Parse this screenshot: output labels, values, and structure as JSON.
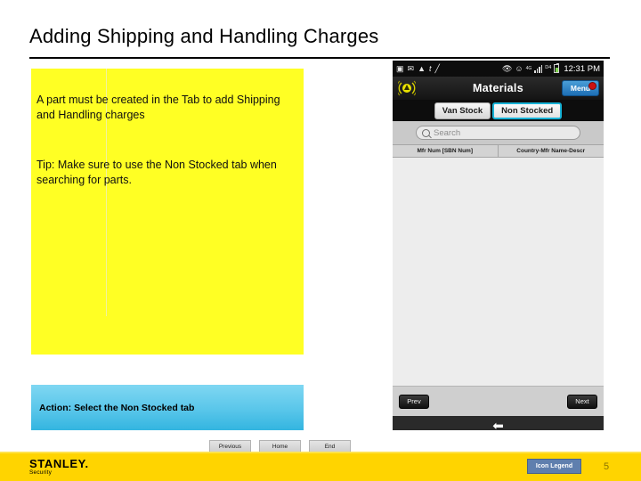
{
  "slide": {
    "title": "Adding Shipping and Handling Charges",
    "page_number": "5"
  },
  "note": {
    "paragraph1": "A part must be created in the Tab to add Shipping and Handling charges",
    "paragraph2": "Tip: Make sure to use the Non Stocked tab when searching for parts."
  },
  "action": {
    "text": "Action:  Select the Non Stocked tab"
  },
  "slide_nav": {
    "previous_label": "Previous",
    "home_label": "Home",
    "end_label": "End"
  },
  "footer": {
    "logo_main": "STANLEY.",
    "logo_sub": "Security",
    "legend_label": "Icon Legend"
  },
  "device": {
    "status_bar": {
      "icons_left": [
        "image-icon",
        "mail-icon",
        "warning-icon",
        "text-cursor-icon",
        "pencil-icon"
      ],
      "icons_right": [
        "eye-icon",
        "wifi-icon",
        "4g-icon",
        "signal-bars-icon",
        "sync-icon",
        "battery-icon"
      ],
      "network_label": "4G",
      "sync_label": "D4",
      "time": "12:31 PM"
    },
    "app_bar": {
      "title": "Materials",
      "menu_label": "Menu",
      "signal_icon": "broadcast-signal-icon",
      "badge_icon": "alert-badge-icon"
    },
    "tabs": [
      {
        "label": "Van Stock",
        "active": false
      },
      {
        "label": "Non Stocked",
        "active": true
      }
    ],
    "search": {
      "placeholder": "Search",
      "icon": "magnifier-icon"
    },
    "columns": [
      {
        "label": "Mfr Num [SBN Num]"
      },
      {
        "label": "Country-Mfr Name-Descr"
      }
    ],
    "pagination": {
      "prev_label": "Prev",
      "next_label": "Next"
    },
    "soft_keys": {
      "back_icon": "back-arrow-icon"
    }
  },
  "colors": {
    "note_yellow": "#ffff24",
    "action_blue": "#33b5e0",
    "footer_yellow": "#ffd400",
    "tab_highlight": "#17b2d6",
    "menu_blue": "#1d6fb5",
    "badge_red": "#cc1111"
  }
}
